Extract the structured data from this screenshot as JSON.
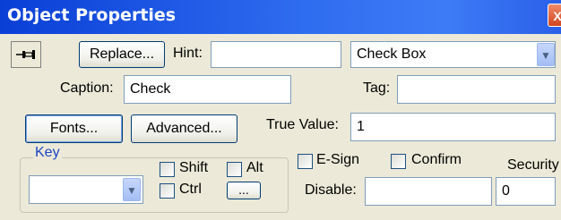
{
  "window": {
    "title": "Object Properties",
    "close_glyph": "X"
  },
  "toolbar": {
    "pin_icon": "pushpin-icon",
    "replace_label": "Replace...",
    "hint_label": "Hint:",
    "hint_value": "",
    "type_value": "Check Box"
  },
  "caption": {
    "label": "Caption:",
    "value": "Check"
  },
  "tag": {
    "label": "Tag:",
    "value": ""
  },
  "buttons": {
    "fonts": "Fonts...",
    "advanced": "Advanced...",
    "ellipsis": "..."
  },
  "true_value": {
    "label": "True Value:",
    "value": "1"
  },
  "key": {
    "group_label": "Key",
    "select_value": "",
    "shift_label": "Shift",
    "alt_label": "Alt",
    "ctrl_label": "Ctrl"
  },
  "options": {
    "esign_label": "E-Sign",
    "confirm_label": "Confirm",
    "security_label": "Security",
    "security_value": "0"
  },
  "disable": {
    "label": "Disable:",
    "value": ""
  }
}
